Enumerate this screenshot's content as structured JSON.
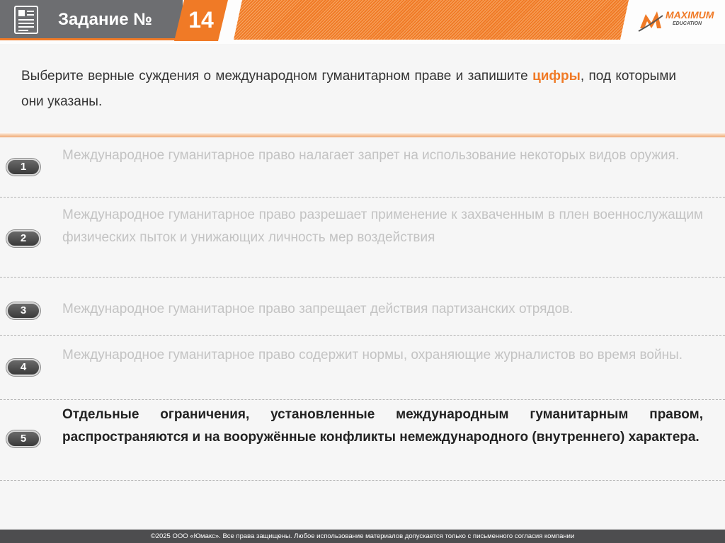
{
  "header": {
    "task_label": "Задание №",
    "task_number": "14",
    "icon": "document-icon",
    "logo": {
      "name": "MAXIMUM",
      "sub": "EDUCATION",
      "icon": "brand-logo-icon"
    }
  },
  "question": {
    "part1": "Выберите верные суждения о международном гуманитарном праве и запишите ",
    "accent": "цифры",
    "part2": ", под которыми они указаны."
  },
  "options": [
    {
      "number": "1",
      "text": "Международное гуманитарное право налагает запрет на использование некоторых видов оружия."
    },
    {
      "number": "2",
      "text": "Международное гуманитарное право разрешает применение к захваченным в плен военнослужащим физических пыток и унижающих личность мер воздействия"
    },
    {
      "number": "3",
      "text": "Международное гуманитарное право запрещает действия партизанских отрядов."
    },
    {
      "number": "4",
      "text": "Международное гуманитарное право содержит нормы, охраняющие журналистов во время войны."
    },
    {
      "number": "5",
      "text": "Отдельные ограничения, установленные международным гуманитарным правом, распространяются и на вооружённые конфликты немеждународного (внутреннего) характера."
    }
  ],
  "footer": {
    "text": "©2025 ООО «Юмакс». Все права защищены. Любое использование материалов допускается только с  письменного согласия компании"
  },
  "colors": {
    "accent": "#f07a26",
    "header_gray": "#6d6e71",
    "muted_text": "#c3c3c3",
    "footer_bg": "#4d4d4f"
  }
}
